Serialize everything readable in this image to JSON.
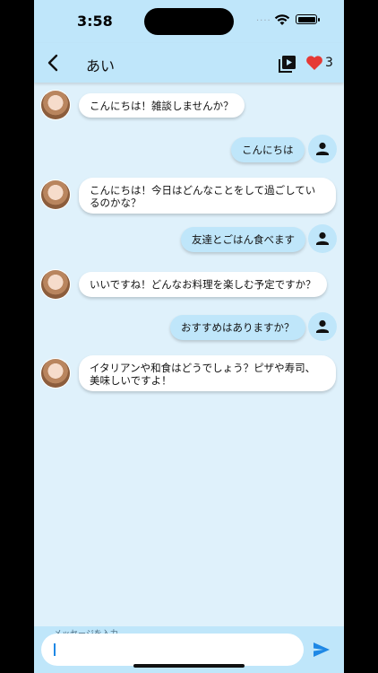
{
  "status_bar": {
    "time": "3:58"
  },
  "header": {
    "title": "あい",
    "heart_count": "3",
    "back_icon": "chevron-left-icon",
    "video_icon": "video-library-icon",
    "heart_icon": "heart-icon",
    "heart_color": "#e53935"
  },
  "messages": [
    {
      "sender": "ai",
      "text": "こんにちは！雑談しませんか？"
    },
    {
      "sender": "user",
      "text": "こんにちは"
    },
    {
      "sender": "ai",
      "text": "こんにちは！今日はどんなことをして過ごしているのかな？"
    },
    {
      "sender": "user",
      "text": "友達とごはん食べます"
    },
    {
      "sender": "ai",
      "text": "いいですね！どんなお料理を楽しむ予定ですか？"
    },
    {
      "sender": "user",
      "text": "おすすめはありますか？"
    },
    {
      "sender": "ai",
      "text": "イタリアンや和食はどうでしょう？ピザや寿司、美味しいですよ！"
    }
  ],
  "composer": {
    "label": "メッセージを入力",
    "value": "",
    "send_icon": "send-icon"
  },
  "colors": {
    "background": "#dff1fb",
    "header": "#bfe6fa",
    "user_bubble": "#bfe6fa",
    "ai_bubble": "#ffffff",
    "accent": "#1e88e5"
  }
}
